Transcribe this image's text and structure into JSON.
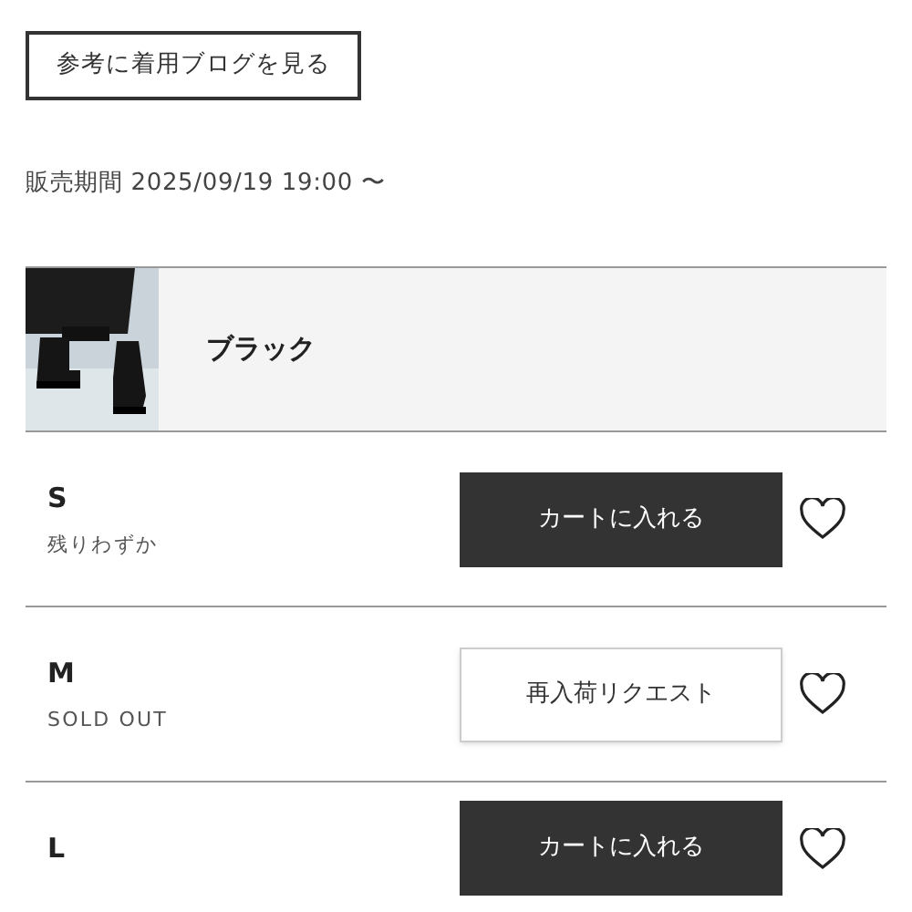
{
  "blog_button": {
    "label": "参考に着用ブログを見る"
  },
  "sale_period": "販売期間 2025/09/19 19:00 〜",
  "color_option": {
    "name": "ブラック"
  },
  "sizes": [
    {
      "size": "S",
      "stock": "残りわずか",
      "button": {
        "kind": "cart",
        "label": "カートに入れる"
      }
    },
    {
      "size": "M",
      "stock": "SOLD OUT",
      "button": {
        "kind": "restock",
        "label": "再入荷リクエスト"
      }
    },
    {
      "size": "L",
      "button": {
        "kind": "cart",
        "label": "カートに入れる"
      }
    }
  ]
}
